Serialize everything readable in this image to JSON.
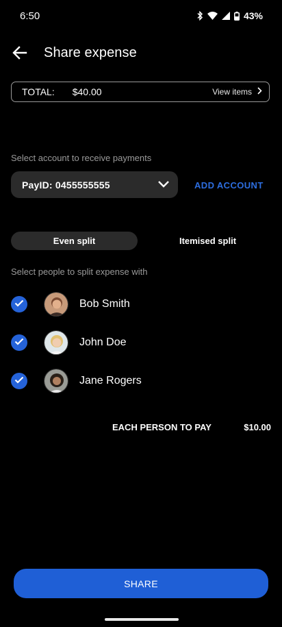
{
  "status_bar": {
    "time": "6:50",
    "battery": "43%",
    "icons": [
      "bluetooth-icon",
      "wifi-icon",
      "cellular-signal-icon",
      "battery-icon"
    ]
  },
  "header": {
    "title": "Share expense",
    "back_icon": "back-arrow-icon"
  },
  "total": {
    "label": "TOTAL:",
    "amount": "$40.00",
    "view_items": "View items"
  },
  "account": {
    "label": "Select account to receive payments",
    "selected": "PayID: 0455555555",
    "add_account": "ADD ACCOUNT"
  },
  "split": {
    "even": "Even split",
    "itemised": "Itemised split",
    "selected": "even"
  },
  "people": {
    "label": "Select people to split expense with",
    "items": [
      {
        "name": "Bob Smith",
        "checked": true
      },
      {
        "name": "John Doe",
        "checked": true
      },
      {
        "name": "Jane Rogers",
        "checked": true
      }
    ]
  },
  "summary": {
    "label": "EACH PERSON TO PAY",
    "amount": "$10.00"
  },
  "share_button": "SHARE",
  "colors": {
    "accent": "#1f5fd6",
    "link": "#2d6ee0",
    "background": "#000000",
    "surface": "#2b2b2b"
  }
}
